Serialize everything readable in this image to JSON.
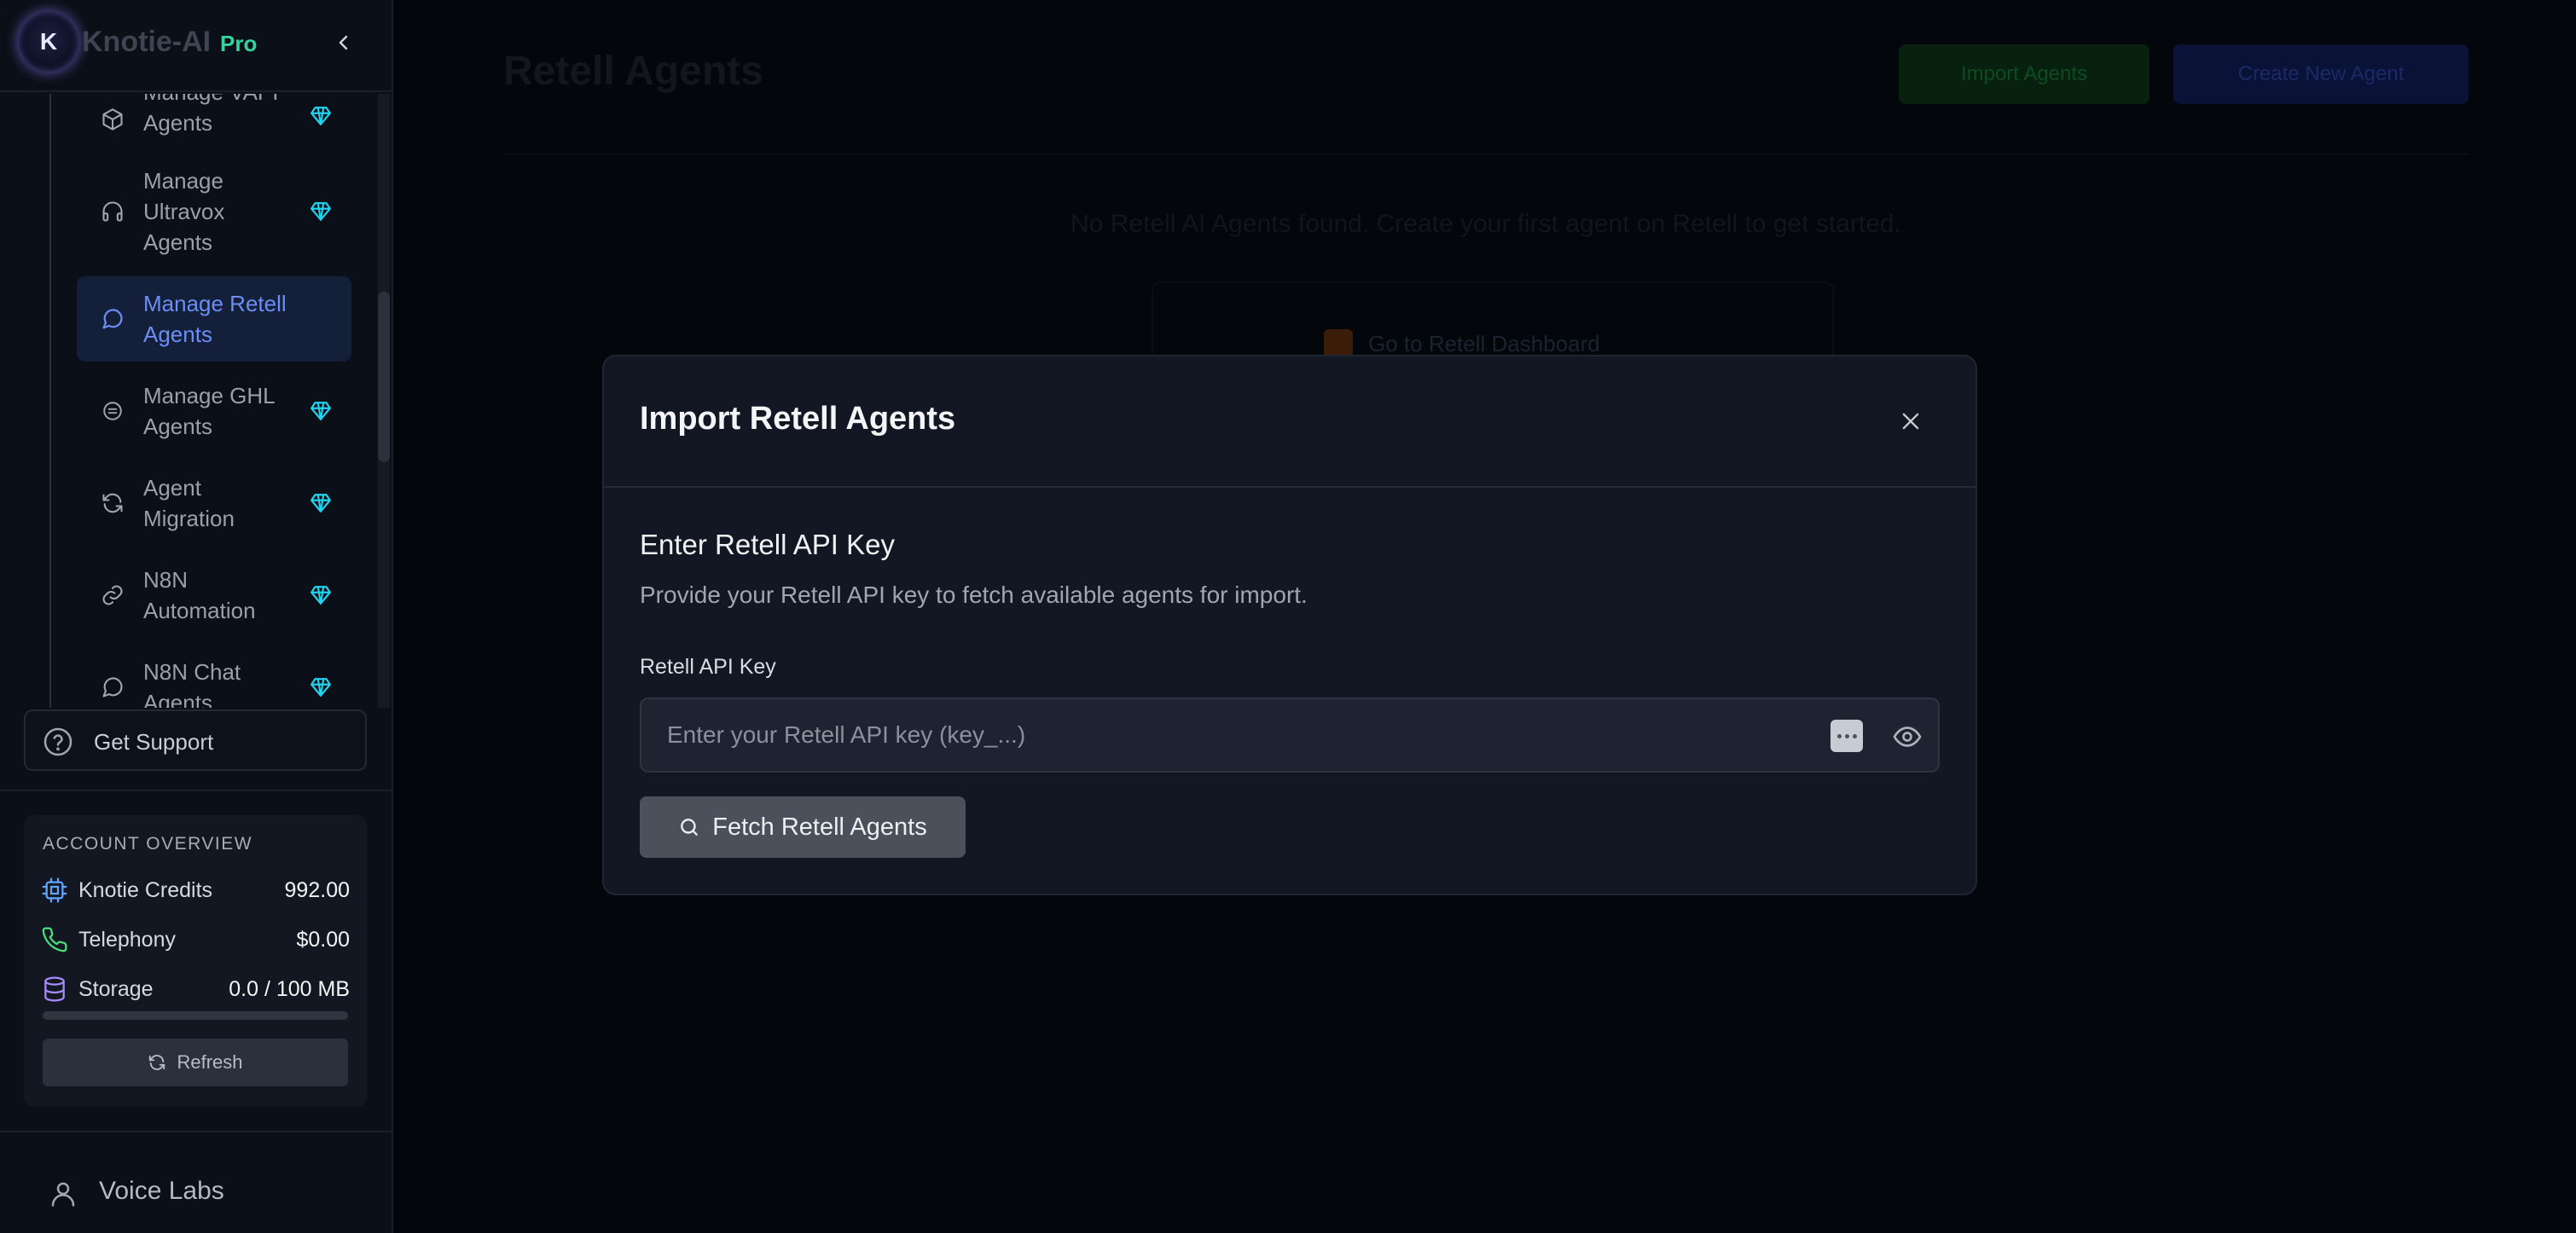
{
  "brand": {
    "initial": "K",
    "name": "Knotie-AI",
    "tier": "Pro"
  },
  "sidebar": {
    "items": [
      {
        "label_1": "Manage VAPI",
        "label_2": "Agents",
        "icon": "cube-icon",
        "premium": true,
        "active": false
      },
      {
        "label_1": "Manage",
        "label_2": "Ultravox",
        "label_3": "Agents",
        "icon": "headphones-icon",
        "premium": true,
        "active": false
      },
      {
        "label_1": "Manage Retell",
        "label_2": "Agents",
        "icon": "chat-bubble-icon",
        "premium": false,
        "active": true
      },
      {
        "label_1": "Manage GHL",
        "label_2": "Agents",
        "icon": "ghl-icon",
        "premium": true,
        "active": false
      },
      {
        "label_1": "Agent",
        "label_2": "Migration",
        "icon": "refresh-icon",
        "premium": true,
        "active": false
      },
      {
        "label_1": "N8N",
        "label_2": "Automation",
        "icon": "link-icon",
        "premium": true,
        "active": false
      },
      {
        "label_1": "N8N Chat",
        "label_2": "Agents",
        "icon": "chat-bubble-icon",
        "premium": true,
        "active": false
      }
    ],
    "support_label": "Get Support",
    "account": {
      "title": "ACCOUNT OVERVIEW",
      "credits_label": "Knotie Credits",
      "credits_value": "992.00",
      "telephony_label": "Telephony",
      "telephony_value": "$0.00",
      "storage_label": "Storage",
      "storage_value": "0.0 / 100 MB",
      "storage_used_fraction": 0.0,
      "refresh_label": "Refresh"
    },
    "voice_labs_label": "Voice Labs"
  },
  "background": {
    "page_title": "Retell Agents",
    "import_button": "Import Agents",
    "create_button": "Create New Agent",
    "empty_text": "No Retell AI Agents found. Create your first agent on Retell to get started.",
    "empty_link": "Go to Retell Dashboard"
  },
  "modal": {
    "title": "Import Retell Agents",
    "subtitle": "Enter Retell API Key",
    "description": "Provide your Retell API key to fetch available agents for import.",
    "field_label": "Retell API Key",
    "field_value": "",
    "field_placeholder": "Enter your Retell API key (key_...)",
    "fetch_button": "Fetch Retell Agents"
  },
  "colors": {
    "accent_blue": "#6b8df5",
    "premium_gem": "#22d3ee",
    "pro_badge": "#34d399",
    "credits_icon": "#60a5fa",
    "telephony_icon": "#4ade80",
    "storage_icon": "#a78bfa"
  }
}
